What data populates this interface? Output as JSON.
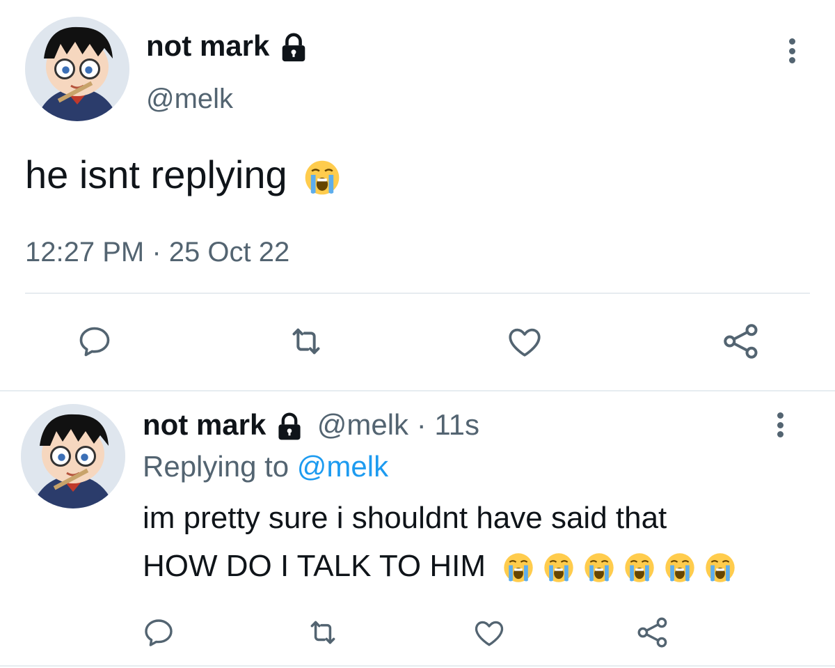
{
  "main_tweet": {
    "display_name": "not mark",
    "handle": "@melk",
    "text": "he isnt replying",
    "timestamp": "12:27 PM · 25 Oct 22",
    "emoji": [
      "loudly-crying-face"
    ],
    "locked": true
  },
  "reply_tweet": {
    "display_name": "not mark",
    "handle": "@melk",
    "time_ago": "· 11s",
    "replying_prefix": "Replying to",
    "replying_to": "@melk",
    "text_line1": "im pretty sure i shouldnt have said that",
    "text_line2": "HOW DO I TALK TO HIM",
    "emoji": [
      "loudly-crying-face",
      "loudly-crying-face",
      "loudly-crying-face",
      "loudly-crying-face",
      "loudly-crying-face",
      "loudly-crying-face"
    ],
    "locked": true
  },
  "actions": [
    "reply-icon",
    "retweet-icon",
    "like-icon",
    "share-icon"
  ],
  "colors": {
    "text": "#0f1419",
    "secondary": "#536471",
    "link": "#1d9bf0",
    "divider": "#e6ecf0"
  }
}
